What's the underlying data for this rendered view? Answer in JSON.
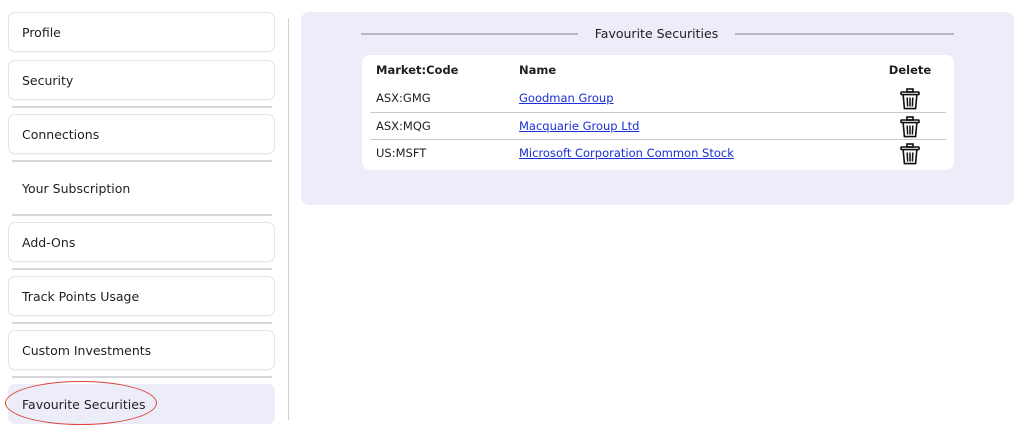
{
  "sidebar": {
    "items": [
      {
        "label": "Profile"
      },
      {
        "label": "Security"
      },
      {
        "label": "Connections"
      },
      {
        "label": "Your Subscription"
      },
      {
        "label": "Add-Ons"
      },
      {
        "label": "Track Points Usage"
      },
      {
        "label": "Custom Investments"
      },
      {
        "label": "Favourite Securities"
      }
    ],
    "active": "Favourite Securities"
  },
  "panel": {
    "title": "Favourite Securities",
    "columns": {
      "code": "Market:Code",
      "name": "Name",
      "delete": "Delete"
    },
    "rows": [
      {
        "code": "ASX:GMG",
        "name": "Goodman Group"
      },
      {
        "code": "ASX:MQG",
        "name": "Macquarie Group Ltd"
      },
      {
        "code": "US:MSFT",
        "name": "Microsoft Corporation Common Stock"
      }
    ],
    "delete_icon": "trash-icon"
  },
  "colors": {
    "panel_bg": "#ededf9",
    "link": "#1a2fd4",
    "highlight": "#d9453a"
  }
}
